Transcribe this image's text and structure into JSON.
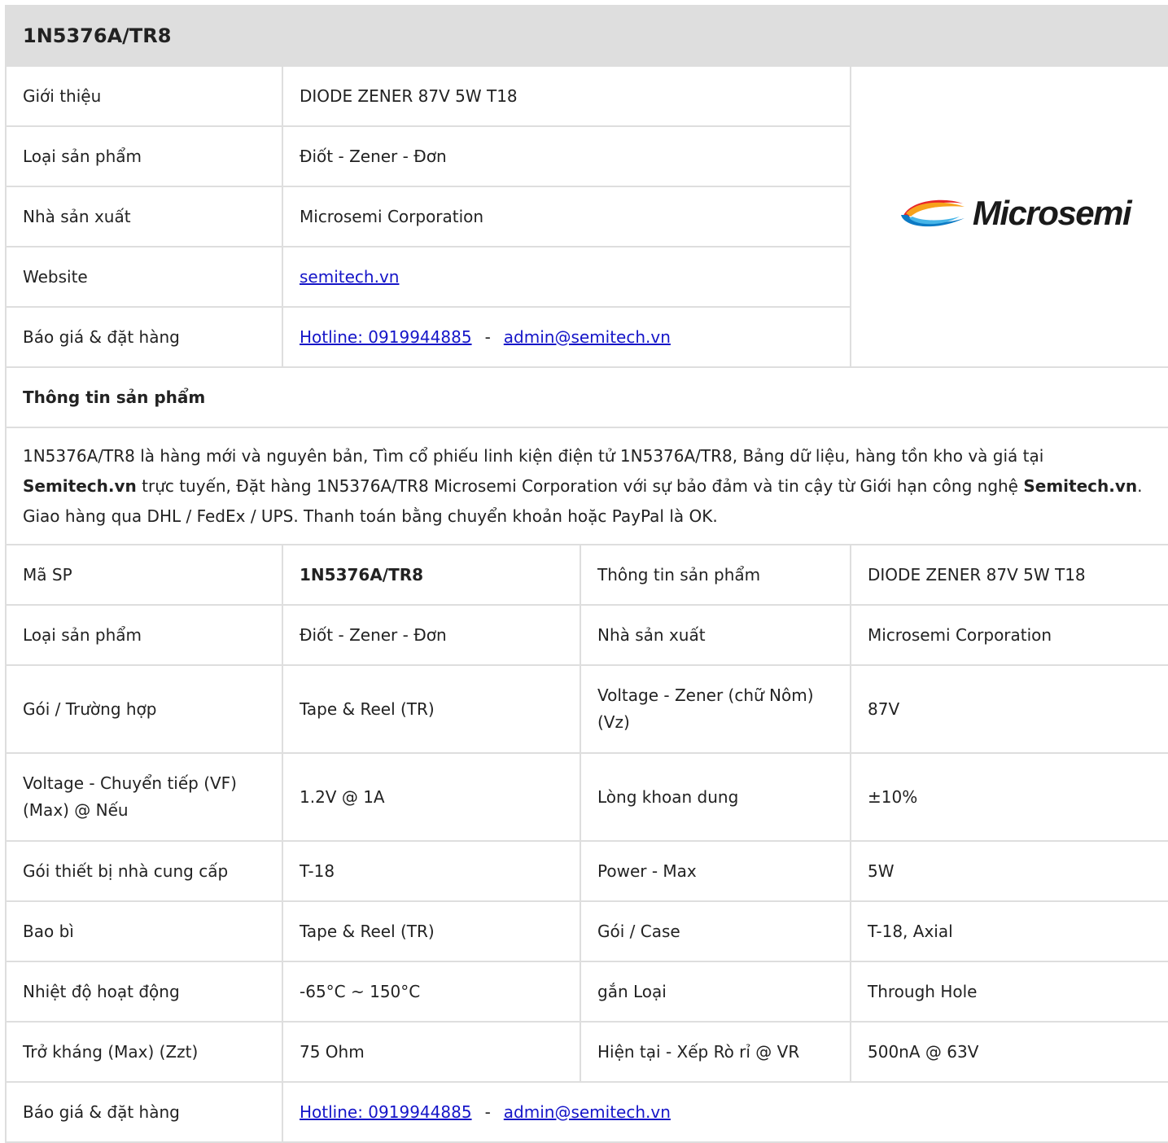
{
  "header": {
    "title": "1N5376A/TR8"
  },
  "summary": {
    "rows": [
      {
        "label": "Giới thiệu",
        "value": "DIODE ZENER 87V 5W T18"
      },
      {
        "label": "Loại sản phẩm",
        "value": "Điốt - Zener - Đơn"
      },
      {
        "label": "Nhà sản xuất",
        "value": "Microsemi Corporation"
      },
      {
        "label": "Website",
        "link": "semitech.vn"
      },
      {
        "label": "Báo giá & đặt hàng",
        "hotline": "Hotline: 0919944885",
        "separator": "-",
        "email": "admin@semitech.vn"
      }
    ],
    "logo": {
      "text": "Microsemi",
      "icon": "microsemi-swirl-logo",
      "colors": [
        "#e8262a",
        "#f7a21b",
        "#0c7ac4",
        "#46b5e8"
      ]
    }
  },
  "info": {
    "heading": "Thông tin sản phẩm",
    "description": {
      "p1": "1N5376A/TR8 là hàng mới và nguyên bản, Tìm cổ phiếu linh kiện điện tử 1N5376A/TR8, Bảng dữ liệu, hàng tồn kho và giá tại ",
      "b1": "Semitech.vn",
      "p2": " trực tuyến, Đặt hàng 1N5376A/TR8 Microsemi Corporation với sự bảo đảm và tin cậy từ Giới hạn công nghệ ",
      "b2": "Semitech.vn",
      "p3": ". Giao hàng qua DHL / FedEx / UPS. Thanh toán bằng chuyển khoản hoặc PayPal là OK."
    }
  },
  "specs": {
    "rows": [
      {
        "l1": "Mã SP",
        "v1": "1N5376A/TR8",
        "l2": "Thông tin sản phẩm",
        "v2": "DIODE ZENER 87V 5W T18"
      },
      {
        "l1": "Loại sản phẩm",
        "v1": "Điốt - Zener - Đơn",
        "l2": "Nhà sản xuất",
        "v2": "Microsemi Corporation"
      },
      {
        "l1": "Gói / Trường hợp",
        "v1": "Tape & Reel (TR)",
        "l2": "Voltage - Zener (chữ Nôm) (Vz)",
        "v2": "87V"
      },
      {
        "l1": "Voltage - Chuyển tiếp (VF) (Max) @ Nếu",
        "v1": "1.2V @ 1A",
        "l2": "Lòng khoan dung",
        "v2": "±10%"
      },
      {
        "l1": "Gói thiết bị nhà cung cấp",
        "v1": "T-18",
        "l2": "Power - Max",
        "v2": "5W"
      },
      {
        "l1": "Bao bì",
        "v1": "Tape & Reel (TR)",
        "l2": "Gói / Case",
        "v2": "T-18, Axial"
      },
      {
        "l1": "Nhiệt độ hoạt động",
        "v1": "-65°C ~ 150°C",
        "l2": "gắn Loại",
        "v2": "Through Hole"
      },
      {
        "l1": "Trở kháng (Max) (Zzt)",
        "v1": "75 Ohm",
        "l2": "Hiện tại - Xếp Rò rỉ @ VR",
        "v2": "500nA @ 63V"
      }
    ],
    "order": {
      "label": "Báo giá & đặt hàng",
      "hotline": "Hotline: 0919944885",
      "separator": "-",
      "email": "admin@semitech.vn"
    }
  }
}
